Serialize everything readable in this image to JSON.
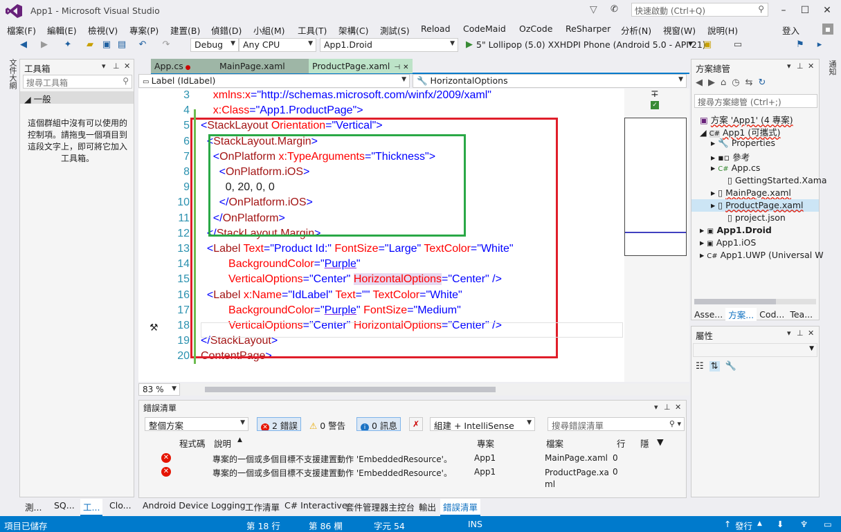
{
  "window": {
    "title": "App1 - Microsoft Visual Studio",
    "quick_launch": "快速啟動 (Ctrl+Q)"
  },
  "menu": [
    "檔案(F)",
    "編輯(E)",
    "檢視(V)",
    "專案(P)",
    "建置(B)",
    "偵錯(D)",
    "小組(M)",
    "工具(T)",
    "架構(C)",
    "測試(S)",
    "Reload",
    "CodeMaid",
    "OzCode",
    "ReSharper",
    "分析(N)",
    "視窗(W)",
    "說明(H)"
  ],
  "sign_in": "登入",
  "toolbar": {
    "config": "Debug",
    "platform": "Any CPU",
    "startup": "App1.Droid",
    "run_target": "5\" Lollipop (5.0) XXHDPI Phone (Android 5.0 - API 21)"
  },
  "left_strip_label": "文件大綱",
  "toolbox": {
    "title": "工具箱",
    "search_placeholder": "搜尋工具箱",
    "group": "◢ 一般",
    "empty_text": "這個群組中沒有可以使用的控制項。請拖曳一個項目到這段文字上，即可將它加入工具箱。"
  },
  "editor_tabs": [
    {
      "label": "App.cs"
    },
    {
      "label": "MainPage.xaml"
    },
    {
      "label": "ProductPage.xaml"
    }
  ],
  "nav": {
    "left": "Label (IdLabel)",
    "right": "HorizontalOptions"
  },
  "zoom": "83 %",
  "code_lines": [
    {
      "n": "3",
      "html": "    <span class='a'>xmlns:x</span><span class='p'>=</span><span class='v'>\"http://schemas.microsoft.com/winfx/2009/xaml\"</span>"
    },
    {
      "n": "4",
      "html": "    <span class='a'>x:Class</span><span class='p'>=</span><span class='v'>\"App1.ProductPage\"</span><span class='p'>&gt;</span>"
    },
    {
      "n": "5",
      "html": "<span class='p'>&lt;</span><span class='t'>StackLayout</span> <span class='a'>Orientation</span><span class='p'>=</span><span class='v'>\"Vertical\"</span><span class='p'>&gt;</span>"
    },
    {
      "n": "6",
      "html": "  <span class='p'>&lt;</span><span class='t'>StackLayout.Margin</span><span class='p'>&gt;</span>"
    },
    {
      "n": "7",
      "html": "    <span class='p'>&lt;</span><span class='t'>OnPlatform</span> <span class='a'>x:TypeArguments</span><span class='p'>=</span><span class='v'>\"Thickness\"</span><span class='p'>&gt;</span>"
    },
    {
      "n": "8",
      "html": "      <span class='p'>&lt;</span><span class='t'>OnPlatform.iOS</span><span class='p'>&gt;</span>"
    },
    {
      "n": "9",
      "html": "        0, 20, 0, 0"
    },
    {
      "n": "10",
      "html": "      <span class='p'>&lt;/</span><span class='t'>OnPlatform.iOS</span><span class='p'>&gt;</span>"
    },
    {
      "n": "11",
      "html": "    <span class='p'>&lt;/</span><span class='t'>OnPlatform</span><span class='p'>&gt;</span>"
    },
    {
      "n": "12",
      "html": "  <span class='p'>&lt;/</span><span class='t'>StackLayout.Margin</span><span class='p'>&gt;</span>"
    },
    {
      "n": "13",
      "html": "  <span class='p'>&lt;</span><span class='t'>Label</span> <span class='a'>Text</span><span class='p'>=</span><span class='v'>\"Product Id:\"</span> <span class='a'>FontSize</span><span class='p'>=</span><span class='v'>\"Large\"</span> <span class='a'>TextColor</span><span class='p'>=</span><span class='v'>\"White\"</span>"
    },
    {
      "n": "14",
      "html": "         <span class='a'>BackgroundColor</span><span class='p'>=</span><span class='v'>\"<u style='text-decoration-color:#8a2be2'>Purple</u>\"</span>"
    },
    {
      "n": "15",
      "html": "         <span class='a'>VerticalOptions</span><span class='p'>=</span><span class='v'>\"Center\"</span> <span class='a' style='background:#e6d8f0'>HorizontalOptions</span><span class='p'>=</span><span class='v'>\"Center\"</span> <span class='p'>/&gt;</span>"
    },
    {
      "n": "16",
      "html": "  <span class='p'>&lt;</span><span class='t'>Label</span> <span class='a'>x:Name</span><span class='p'>=</span><span class='v'>\"IdLabel\"</span> <span class='a'>Text</span><span class='p'>=</span><span class='v'>\"\"</span> <span class='a'>TextColor</span><span class='p'>=</span><span class='v'>\"White\"</span>"
    },
    {
      "n": "17",
      "html": "         <span class='a'>BackgroundColor</span><span class='p'>=</span><span class='v'>\"<u style='text-decoration-color:#8a2be2'>Purple</u>\"</span> <span class='a'>FontSize</span><span class='p'>=</span><span class='v'>\"Medium\"</span>"
    },
    {
      "n": "18",
      "html": "         <span class='a'>VerticalOptions</span><span class='p'>=</span><span class='v'>\"Center\"</span> <span class='a'>HorizontalOptions</span><span class='p'>=</span><span class='v'>\"Center\"</span> <span class='p'>/&gt;</span>"
    },
    {
      "n": "19",
      "html": "<span class='p'>&lt;/</span><span class='t'>StackLayout</span><span class='p'>&gt;</span>"
    },
    {
      "n": "20",
      "html": "<span class='t'>ContentPage</span><span class='p'>&gt;</span>"
    }
  ],
  "errors": {
    "title": "錯誤清單",
    "scope": "整個方案",
    "errors_btn": "2 錯誤",
    "warnings_btn": "0 警告",
    "messages_btn": "0 訊息",
    "build_filter": "組建 + IntelliSense",
    "search_placeholder": "搜尋錯誤清單",
    "columns": {
      "code": "程式碼",
      "desc": "說明",
      "project": "專案",
      "file": "檔案",
      "line": "行",
      "hidden": "隱"
    },
    "rows": [
      {
        "desc": "專案的一個或多個目標不支援建置動作 'EmbeddedResource'。",
        "project": "App1",
        "file": "MainPage.xaml",
        "line": "0"
      },
      {
        "desc": "專案的一個或多個目標不支援建置動作 'EmbeddedResource'。",
        "project": "App1",
        "file": "ProductPage.xa ml",
        "line": "0"
      }
    ]
  },
  "left_bottom_tabs": [
    "測...",
    "SQ...",
    "工...",
    "Clo..."
  ],
  "bottom_tabs": [
    "Android Device Logging",
    "工作清單",
    "C# Interactive",
    "套件管理器主控台",
    "輸出",
    "錯誤清單"
  ],
  "solution": {
    "title": "方案總管",
    "search_placeholder": "搜尋方案總管 (Ctrl+;)",
    "items": [
      "方案 'App1' (4 專案)",
      "App1 (可攜式)",
      "Properties",
      "參考",
      "App.cs",
      "GettingStarted.Xama",
      "MainPage.xaml",
      "ProductPage.xaml",
      "project.json",
      "App1.Droid",
      "App1.iOS",
      "App1.UWP (Universal W"
    ],
    "tabs": [
      "Asse...",
      "方案...",
      "Cod...",
      "Tea..."
    ]
  },
  "properties": {
    "title": "屬性"
  },
  "right_strip_label": "通知",
  "status": {
    "saved": "項目已儲存",
    "line": "第 18 行",
    "col": "第 86 欄",
    "char": "字元 54",
    "mode": "INS",
    "publish": "發行"
  }
}
